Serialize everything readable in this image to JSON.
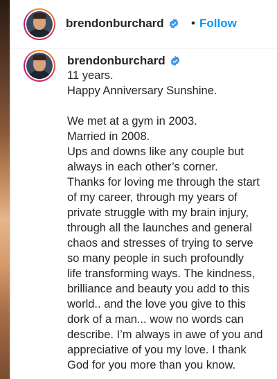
{
  "header": {
    "username": "brendonburchard",
    "separator": "•",
    "follow_label": "Follow",
    "more_label": "•"
  },
  "caption": {
    "username": "brendonburchard",
    "lines": [
      "11 years.",
      "Happy Anniversary Sunshine.",
      "",
      "We met at a gym in 2003.",
      "Married in 2008.",
      "Ups and downs like any couple but",
      "always in each other’s corner.",
      "Thanks for loving me through the start",
      "of my career, through my years of",
      "private struggle with my brain injury,",
      "through all the launches and general",
      "chaos and stresses of trying to serve",
      "so many people in such profoundly",
      "life transforming ways. The kindness,",
      "brilliance and beauty you add to this",
      "world.. and the love you give to this",
      "dork of a man... wow no words can",
      "describe. I’m always in awe of you and",
      "appreciative of you my love. I thank",
      "God for you more than you know."
    ]
  },
  "colors": {
    "accent": "#0095f6",
    "text": "#262626",
    "verified": "#3897f0"
  },
  "icons": {
    "verified": "verified-badge-icon",
    "more": "more-options-icon"
  }
}
